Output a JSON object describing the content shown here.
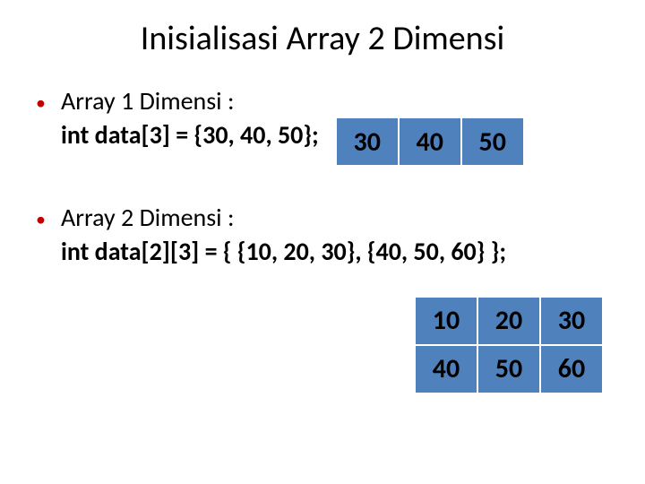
{
  "title": "Inisialisasi Array 2 Dimensi",
  "bullets": [
    {
      "heading": "Array 1 Dimensi :",
      "code": "int data[3] = {30, 40, 50};",
      "table": {
        "rows": [
          [
            "30",
            "40",
            "50"
          ]
        ]
      }
    },
    {
      "heading": "Array 2 Dimensi :",
      "code": "int data[2][3] = { {10, 20, 30}, {40, 50, 60} };",
      "table": {
        "rows": [
          [
            "10",
            "20",
            "30"
          ],
          [
            "40",
            "50",
            "60"
          ]
        ]
      }
    }
  ],
  "colors": {
    "bullet": "#C00000",
    "cell_bg": "#4F81BD"
  }
}
